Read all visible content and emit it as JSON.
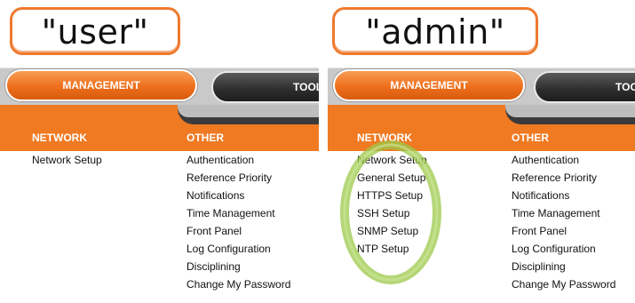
{
  "panels": [
    {
      "label": "\"user\"",
      "tabs": {
        "management": "MANAGEMENT",
        "tools": "TOOLS"
      },
      "network_header": "NETWORK",
      "other_header": "OTHER",
      "network_items": [
        "Network Setup"
      ],
      "other_items": [
        "Authentication",
        "Reference Priority",
        "Notifications",
        "Time Management",
        "Front Panel",
        "Log Configuration",
        "Disciplining",
        "Change My Password"
      ]
    },
    {
      "label": "\"admin\"",
      "tabs": {
        "management": "MANAGEMENT",
        "tools": "TOOLS"
      },
      "network_header": "NETWORK",
      "other_header": "OTHER",
      "network_items": [
        "Network Setup",
        "General Setup",
        "HTTPS Setup",
        "SSH Setup",
        "SNMP Setup",
        "NTP Setup"
      ],
      "other_items": [
        "Authentication",
        "Reference Priority",
        "Notifications",
        "Time Management",
        "Front Panel",
        "Log Configuration",
        "Disciplining",
        "Change My Password"
      ]
    }
  ],
  "colors": {
    "accent": "#f07a22",
    "highlight": "#9cc84a"
  }
}
